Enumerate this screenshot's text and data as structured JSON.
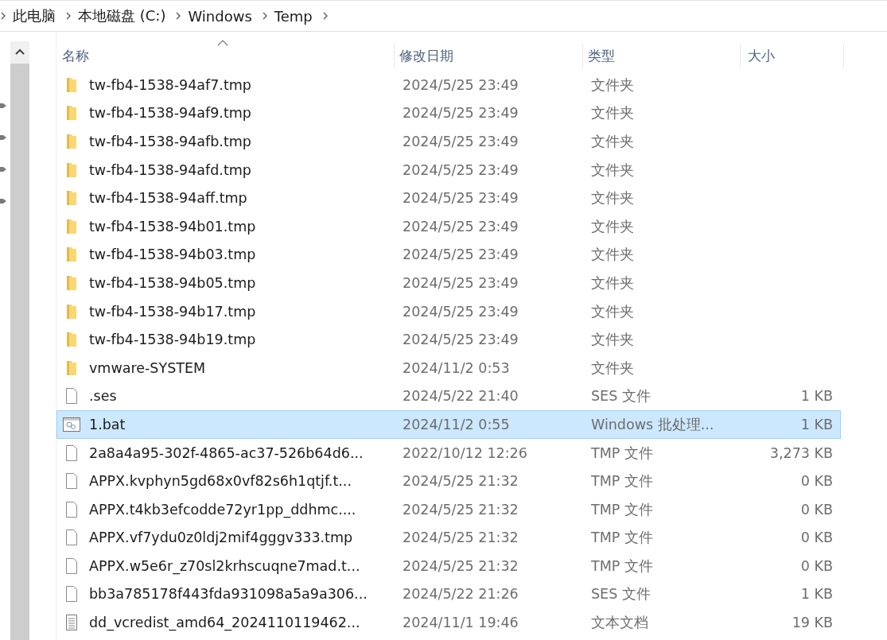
{
  "breadcrumb": [
    "此电脑",
    "本地磁盘 (C:)",
    "Windows",
    "Temp"
  ],
  "columns": [
    "名称",
    "修改日期",
    "类型",
    "大小"
  ],
  "rows": [
    {
      "kind": "folder",
      "name": "tw-fb4-1538-94af7.tmp",
      "date": "2024/5/25 23:49",
      "type": "文件夹",
      "selected": false
    },
    {
      "kind": "folder",
      "name": "tw-fb4-1538-94af9.tmp",
      "date": "2024/5/25 23:49",
      "type": "文件夹",
      "selected": false
    },
    {
      "kind": "folder",
      "name": "tw-fb4-1538-94afb.tmp",
      "date": "2024/5/25 23:49",
      "type": "文件夹",
      "selected": false
    },
    {
      "kind": "folder",
      "name": "tw-fb4-1538-94afd.tmp",
      "date": "2024/5/25 23:49",
      "type": "文件夹",
      "selected": false
    },
    {
      "kind": "folder",
      "name": "tw-fb4-1538-94aff.tmp",
      "date": "2024/5/25 23:49",
      "type": "文件夹",
      "selected": false
    },
    {
      "kind": "folder",
      "name": "tw-fb4-1538-94b01.tmp",
      "date": "2024/5/25 23:49",
      "type": "文件夹",
      "selected": false
    },
    {
      "kind": "folder",
      "name": "tw-fb4-1538-94b03.tmp",
      "date": "2024/5/25 23:49",
      "type": "文件夹",
      "selected": false
    },
    {
      "kind": "folder",
      "name": "tw-fb4-1538-94b05.tmp",
      "date": "2024/5/25 23:49",
      "type": "文件夹",
      "selected": false
    },
    {
      "kind": "folder",
      "name": "tw-fb4-1538-94b17.tmp",
      "date": "2024/5/25 23:49",
      "type": "文件夹",
      "selected": false
    },
    {
      "kind": "folder",
      "name": "tw-fb4-1538-94b19.tmp",
      "date": "2024/5/25 23:49",
      "type": "文件夹",
      "selected": false
    },
    {
      "kind": "folder",
      "name": "vmware-SYSTEM",
      "date": "2024/11/2 0:53",
      "type": "文件夹",
      "selected": false
    },
    {
      "kind": "file",
      "name": ".ses",
      "date": "2024/5/22 21:40",
      "type": "SES 文件",
      "size": "1 KB",
      "selected": false
    },
    {
      "kind": "batch",
      "name": "1.bat",
      "date": "2024/11/2 0:55",
      "type": "Windows 批处理...",
      "size": "1 KB",
      "selected": true
    },
    {
      "kind": "file",
      "name": "2a8a4a95-302f-4865-ac37-526b64d6...",
      "date": "2022/10/12 12:26",
      "type": "TMP 文件",
      "size": "3,273 KB",
      "selected": false
    },
    {
      "kind": "file",
      "name": "APPX.kvphyn5gd68x0vf82s6h1qtjf.t...",
      "date": "2024/5/25 21:32",
      "type": "TMP 文件",
      "size": "0 KB",
      "selected": false
    },
    {
      "kind": "file",
      "name": "APPX.t4kb3efcodde72yr1pp_ddhmc....",
      "date": "2024/5/25 21:32",
      "type": "TMP 文件",
      "size": "0 KB",
      "selected": false
    },
    {
      "kind": "file",
      "name": "APPX.vf7ydu0z0ldj2mif4gggv333.tmp",
      "date": "2024/5/25 21:32",
      "type": "TMP 文件",
      "size": "0 KB",
      "selected": false
    },
    {
      "kind": "file",
      "name": "APPX.w5e6r_z70sl2krhscuqne7mad.t...",
      "date": "2024/5/25 21:32",
      "type": "TMP 文件",
      "size": "0 KB",
      "selected": false
    },
    {
      "kind": "file",
      "name": "bb3a785178f443fda931098a5a9a306...",
      "date": "2024/5/22 21:26",
      "type": "SES 文件",
      "size": "1 KB",
      "selected": false
    },
    {
      "kind": "text",
      "name": "dd_vcredist_amd64_2024110119462...",
      "date": "2024/11/1 19:46",
      "type": "文本文档",
      "size": "19 KB",
      "selected": false
    }
  ]
}
